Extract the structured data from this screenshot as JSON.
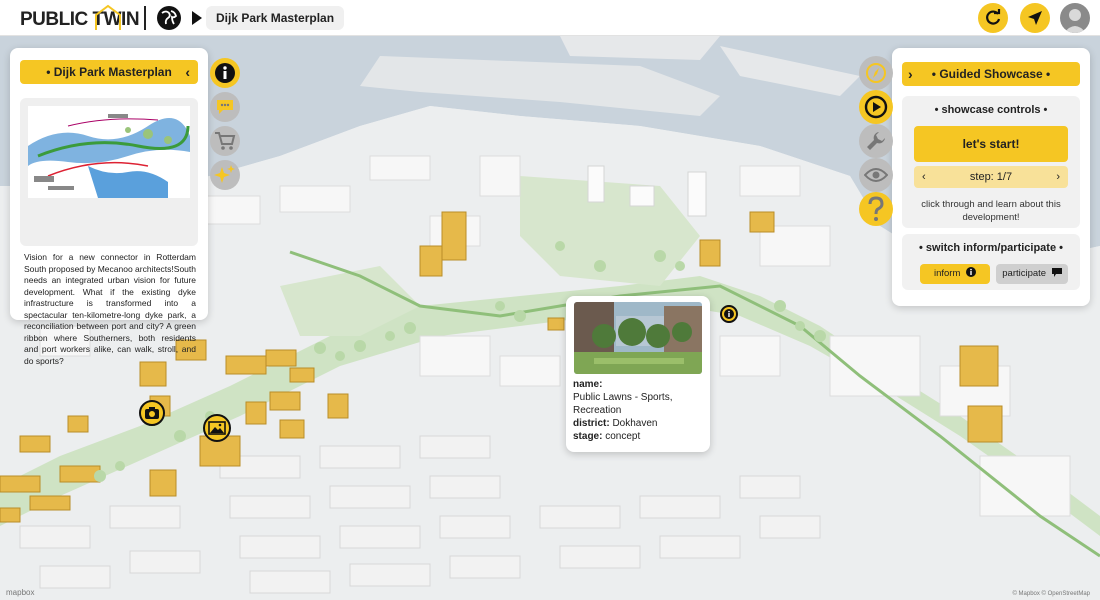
{
  "app": {
    "logo_text": "PUBLIC TWIN",
    "breadcrumb": "Dijk Park Masterplan"
  },
  "left_panel": {
    "title": "• Dijk Park Masterplan",
    "collapse_glyph": "‹",
    "description": "Vision for a new connector in Rotterdam South proposed by Mecanoo architects!South needs an integrated urban vision for future development. What if the existing dyke infrastructure is transformed into a spectacular ten-kilometre-long dyke park, a reconciliation between port and city? A green ribbon where Southerners, both residents and port workers alike, can walk, stroll, and do sports?"
  },
  "left_icons": [
    "info-icon",
    "comment-icon",
    "cart-icon",
    "sparkles-icon"
  ],
  "right_icons": [
    "compass-icon",
    "play-icon",
    "wrench-icon",
    "eye-icon",
    "question-icon"
  ],
  "right_panel": {
    "title": "• Guided Showcase •",
    "expand_glyph": "›",
    "showcase": {
      "title": "• showcase controls •",
      "start_label": "let's start!",
      "step_label": "step: 1/7",
      "prev_glyph": "‹",
      "next_glyph": "›",
      "hint": "click through and learn about this development!"
    },
    "switch": {
      "title": "• switch inform/participate •",
      "inform_label": "inform",
      "participate_label": "participate"
    }
  },
  "popup": {
    "name_key": "name:",
    "name_value": "Public Lawns - Sports, Recreation",
    "district_key": "district:",
    "district_value": "Dokhaven",
    "stage_key": "stage:",
    "stage_value": "concept"
  },
  "map": {
    "attribution_left": "mapbox",
    "attribution_right": "© Mapbox © OpenStreetMap"
  },
  "colors": {
    "accent": "#f5c623",
    "water": "#c9d3dc",
    "park": "#cfe3c4",
    "building": "#e6b94a"
  }
}
